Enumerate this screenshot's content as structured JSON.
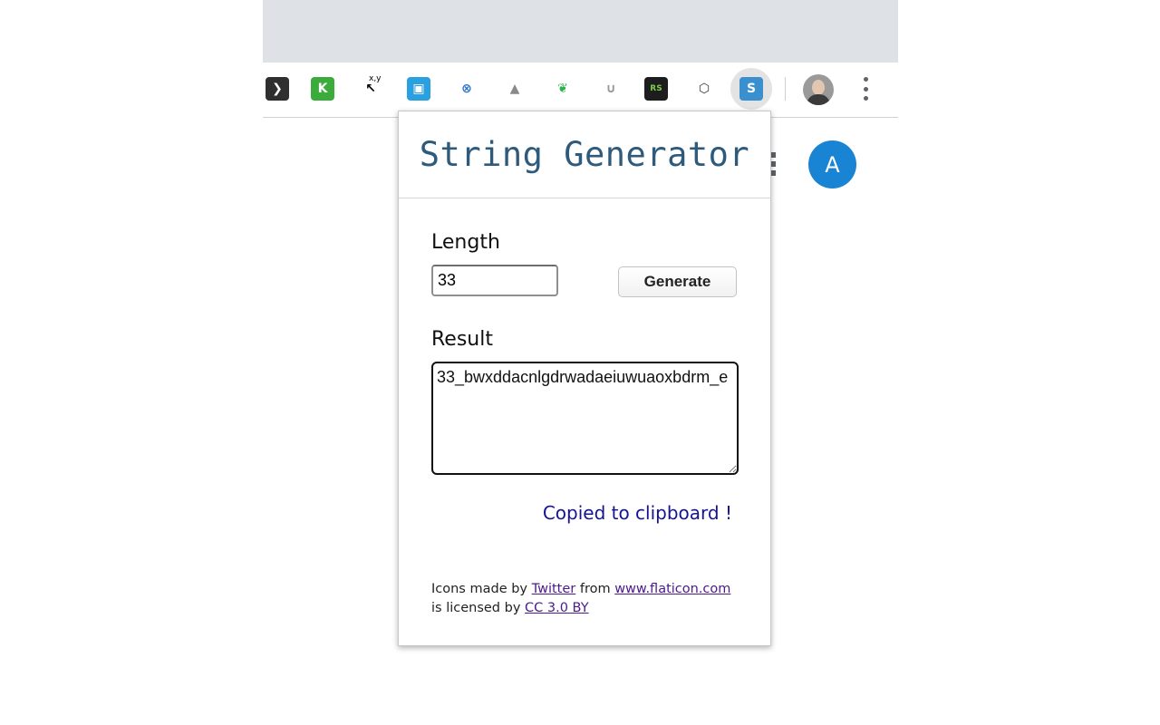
{
  "toolbar": {
    "extensions": [
      {
        "name": "code-extension-icon",
        "glyph": "❯",
        "bg": "#2f2f2f",
        "fg": "#ffffff"
      },
      {
        "name": "k-extension-icon",
        "glyph": "K",
        "bg": "#3bab3b",
        "fg": "#ffffff"
      },
      {
        "name": "cursor-xy-extension-icon",
        "glyph": "↖",
        "bg": "#ffffff",
        "fg": "#000000"
      },
      {
        "name": "window-extension-icon",
        "glyph": "▣",
        "bg": "#2aa0e0",
        "fg": "#ffffff"
      },
      {
        "name": "target-extension-icon",
        "glyph": "⊗",
        "bg": "#ffffff",
        "fg": "#2a74c9"
      },
      {
        "name": "drive-extension-icon",
        "glyph": "▲",
        "bg": "#ffffff",
        "fg": "#8a8a8a"
      },
      {
        "name": "evernote-extension-icon",
        "glyph": "❦",
        "bg": "#ffffff",
        "fg": "#2db24a"
      },
      {
        "name": "magnet-extension-icon",
        "glyph": "∪",
        "bg": "#ffffff",
        "fg": "#9a9a9a"
      },
      {
        "name": "random-string-extension-icon",
        "glyph": "RS",
        "bg": "#1d1d1d",
        "fg": "#7ecb4a"
      },
      {
        "name": "hexagon-extension-icon",
        "glyph": "⬡",
        "bg": "#ffffff",
        "fg": "#333333"
      },
      {
        "name": "s-extension-icon",
        "glyph": "S",
        "bg": "#3a8fcf",
        "fg": "#ffffff"
      }
    ],
    "cursor_label": "x,y"
  },
  "background": {
    "avatar_letter": "A",
    "avatar_color": "#1a84d4"
  },
  "popup": {
    "title": "String Generator",
    "length_label": "Length",
    "length_value": "33",
    "generate_label": "Generate",
    "result_label": "Result",
    "result_value": "33_bwxddacnlgdrwadaeiuwuaoxbdrm_e",
    "copied_message": "Copied to clipboard !",
    "credits": {
      "prefix": "Icons made by ",
      "author_link": "Twitter",
      "middle": " from ",
      "site_link": "www.flaticon.com",
      "suffix": " is licensed by ",
      "license_link": "CC 3.0 BY"
    }
  },
  "colors": {
    "title": "#2e5a7c",
    "copied": "#141491",
    "link": "#4b1a8b"
  }
}
